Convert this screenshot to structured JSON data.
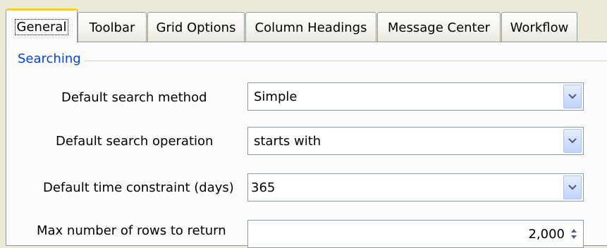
{
  "tabs": [
    "General",
    "Toolbar",
    "Grid Options",
    "Column Headings",
    "Message Center",
    "Workflow"
  ],
  "active_tab": "General",
  "searching": {
    "group_title": "Searching",
    "default_search_method": {
      "label": "Default search method",
      "value": "Simple"
    },
    "default_search_operation": {
      "label": "Default search operation",
      "value": "starts with"
    },
    "default_time_constraint": {
      "label": "Default time constraint (days)",
      "value": "365"
    },
    "max_rows": {
      "label": "Max number of rows to return",
      "value": "2,000"
    }
  },
  "icons": {
    "dropdown": "chevron-down-icon",
    "spinner": "up-down-arrows-icon"
  },
  "colors": {
    "window_bg": "#ece9d8",
    "panel_bg": "#fcfcfe",
    "tab_border": "#919b9c",
    "active_tab_accent": "#ffc83c",
    "group_title": "#0046d5",
    "input_border": "#7f9db9"
  }
}
